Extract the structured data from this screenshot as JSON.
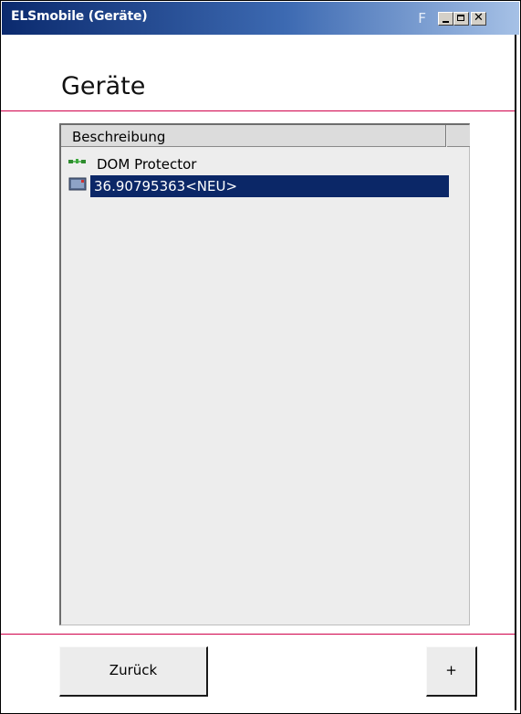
{
  "window": {
    "title": "ELSmobile (Geräte)",
    "title_icon": "touch-keyboard-icon",
    "controls": [
      "minimize-icon",
      "maximize-icon",
      "close-icon"
    ],
    "close_glyph": "✕"
  },
  "page": {
    "heading": "Geräte"
  },
  "list": {
    "column_header": "Beschreibung",
    "items": [
      {
        "label": "DOM Protector",
        "icon": "network-device-icon",
        "selected": false
      },
      {
        "label": "36.90795363<NEU>",
        "icon": "device-new-icon",
        "selected": true
      }
    ]
  },
  "buttons": {
    "back_label": "Zurück",
    "add_label": "+"
  },
  "colors": {
    "titlebar_start": "#0b2a6e",
    "titlebar_end": "#a6c1e6",
    "divider": "#d0004a",
    "selection": "#0b2767"
  }
}
